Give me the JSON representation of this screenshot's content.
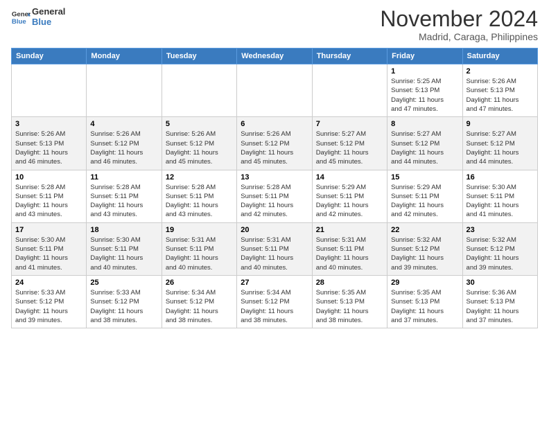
{
  "header": {
    "logo_line1": "General",
    "logo_line2": "Blue",
    "month": "November 2024",
    "location": "Madrid, Caraga, Philippines"
  },
  "weekdays": [
    "Sunday",
    "Monday",
    "Tuesday",
    "Wednesday",
    "Thursday",
    "Friday",
    "Saturday"
  ],
  "weeks": [
    [
      {
        "day": "",
        "info": ""
      },
      {
        "day": "",
        "info": ""
      },
      {
        "day": "",
        "info": ""
      },
      {
        "day": "",
        "info": ""
      },
      {
        "day": "",
        "info": ""
      },
      {
        "day": "1",
        "info": "Sunrise: 5:25 AM\nSunset: 5:13 PM\nDaylight: 11 hours\nand 47 minutes."
      },
      {
        "day": "2",
        "info": "Sunrise: 5:26 AM\nSunset: 5:13 PM\nDaylight: 11 hours\nand 47 minutes."
      }
    ],
    [
      {
        "day": "3",
        "info": "Sunrise: 5:26 AM\nSunset: 5:13 PM\nDaylight: 11 hours\nand 46 minutes."
      },
      {
        "day": "4",
        "info": "Sunrise: 5:26 AM\nSunset: 5:12 PM\nDaylight: 11 hours\nand 46 minutes."
      },
      {
        "day": "5",
        "info": "Sunrise: 5:26 AM\nSunset: 5:12 PM\nDaylight: 11 hours\nand 45 minutes."
      },
      {
        "day": "6",
        "info": "Sunrise: 5:26 AM\nSunset: 5:12 PM\nDaylight: 11 hours\nand 45 minutes."
      },
      {
        "day": "7",
        "info": "Sunrise: 5:27 AM\nSunset: 5:12 PM\nDaylight: 11 hours\nand 45 minutes."
      },
      {
        "day": "8",
        "info": "Sunrise: 5:27 AM\nSunset: 5:12 PM\nDaylight: 11 hours\nand 44 minutes."
      },
      {
        "day": "9",
        "info": "Sunrise: 5:27 AM\nSunset: 5:12 PM\nDaylight: 11 hours\nand 44 minutes."
      }
    ],
    [
      {
        "day": "10",
        "info": "Sunrise: 5:28 AM\nSunset: 5:11 PM\nDaylight: 11 hours\nand 43 minutes."
      },
      {
        "day": "11",
        "info": "Sunrise: 5:28 AM\nSunset: 5:11 PM\nDaylight: 11 hours\nand 43 minutes."
      },
      {
        "day": "12",
        "info": "Sunrise: 5:28 AM\nSunset: 5:11 PM\nDaylight: 11 hours\nand 43 minutes."
      },
      {
        "day": "13",
        "info": "Sunrise: 5:28 AM\nSunset: 5:11 PM\nDaylight: 11 hours\nand 42 minutes."
      },
      {
        "day": "14",
        "info": "Sunrise: 5:29 AM\nSunset: 5:11 PM\nDaylight: 11 hours\nand 42 minutes."
      },
      {
        "day": "15",
        "info": "Sunrise: 5:29 AM\nSunset: 5:11 PM\nDaylight: 11 hours\nand 42 minutes."
      },
      {
        "day": "16",
        "info": "Sunrise: 5:30 AM\nSunset: 5:11 PM\nDaylight: 11 hours\nand 41 minutes."
      }
    ],
    [
      {
        "day": "17",
        "info": "Sunrise: 5:30 AM\nSunset: 5:11 PM\nDaylight: 11 hours\nand 41 minutes."
      },
      {
        "day": "18",
        "info": "Sunrise: 5:30 AM\nSunset: 5:11 PM\nDaylight: 11 hours\nand 40 minutes."
      },
      {
        "day": "19",
        "info": "Sunrise: 5:31 AM\nSunset: 5:11 PM\nDaylight: 11 hours\nand 40 minutes."
      },
      {
        "day": "20",
        "info": "Sunrise: 5:31 AM\nSunset: 5:11 PM\nDaylight: 11 hours\nand 40 minutes."
      },
      {
        "day": "21",
        "info": "Sunrise: 5:31 AM\nSunset: 5:11 PM\nDaylight: 11 hours\nand 40 minutes."
      },
      {
        "day": "22",
        "info": "Sunrise: 5:32 AM\nSunset: 5:12 PM\nDaylight: 11 hours\nand 39 minutes."
      },
      {
        "day": "23",
        "info": "Sunrise: 5:32 AM\nSunset: 5:12 PM\nDaylight: 11 hours\nand 39 minutes."
      }
    ],
    [
      {
        "day": "24",
        "info": "Sunrise: 5:33 AM\nSunset: 5:12 PM\nDaylight: 11 hours\nand 39 minutes."
      },
      {
        "day": "25",
        "info": "Sunrise: 5:33 AM\nSunset: 5:12 PM\nDaylight: 11 hours\nand 38 minutes."
      },
      {
        "day": "26",
        "info": "Sunrise: 5:34 AM\nSunset: 5:12 PM\nDaylight: 11 hours\nand 38 minutes."
      },
      {
        "day": "27",
        "info": "Sunrise: 5:34 AM\nSunset: 5:12 PM\nDaylight: 11 hours\nand 38 minutes."
      },
      {
        "day": "28",
        "info": "Sunrise: 5:35 AM\nSunset: 5:13 PM\nDaylight: 11 hours\nand 38 minutes."
      },
      {
        "day": "29",
        "info": "Sunrise: 5:35 AM\nSunset: 5:13 PM\nDaylight: 11 hours\nand 37 minutes."
      },
      {
        "day": "30",
        "info": "Sunrise: 5:36 AM\nSunset: 5:13 PM\nDaylight: 11 hours\nand 37 minutes."
      }
    ]
  ]
}
